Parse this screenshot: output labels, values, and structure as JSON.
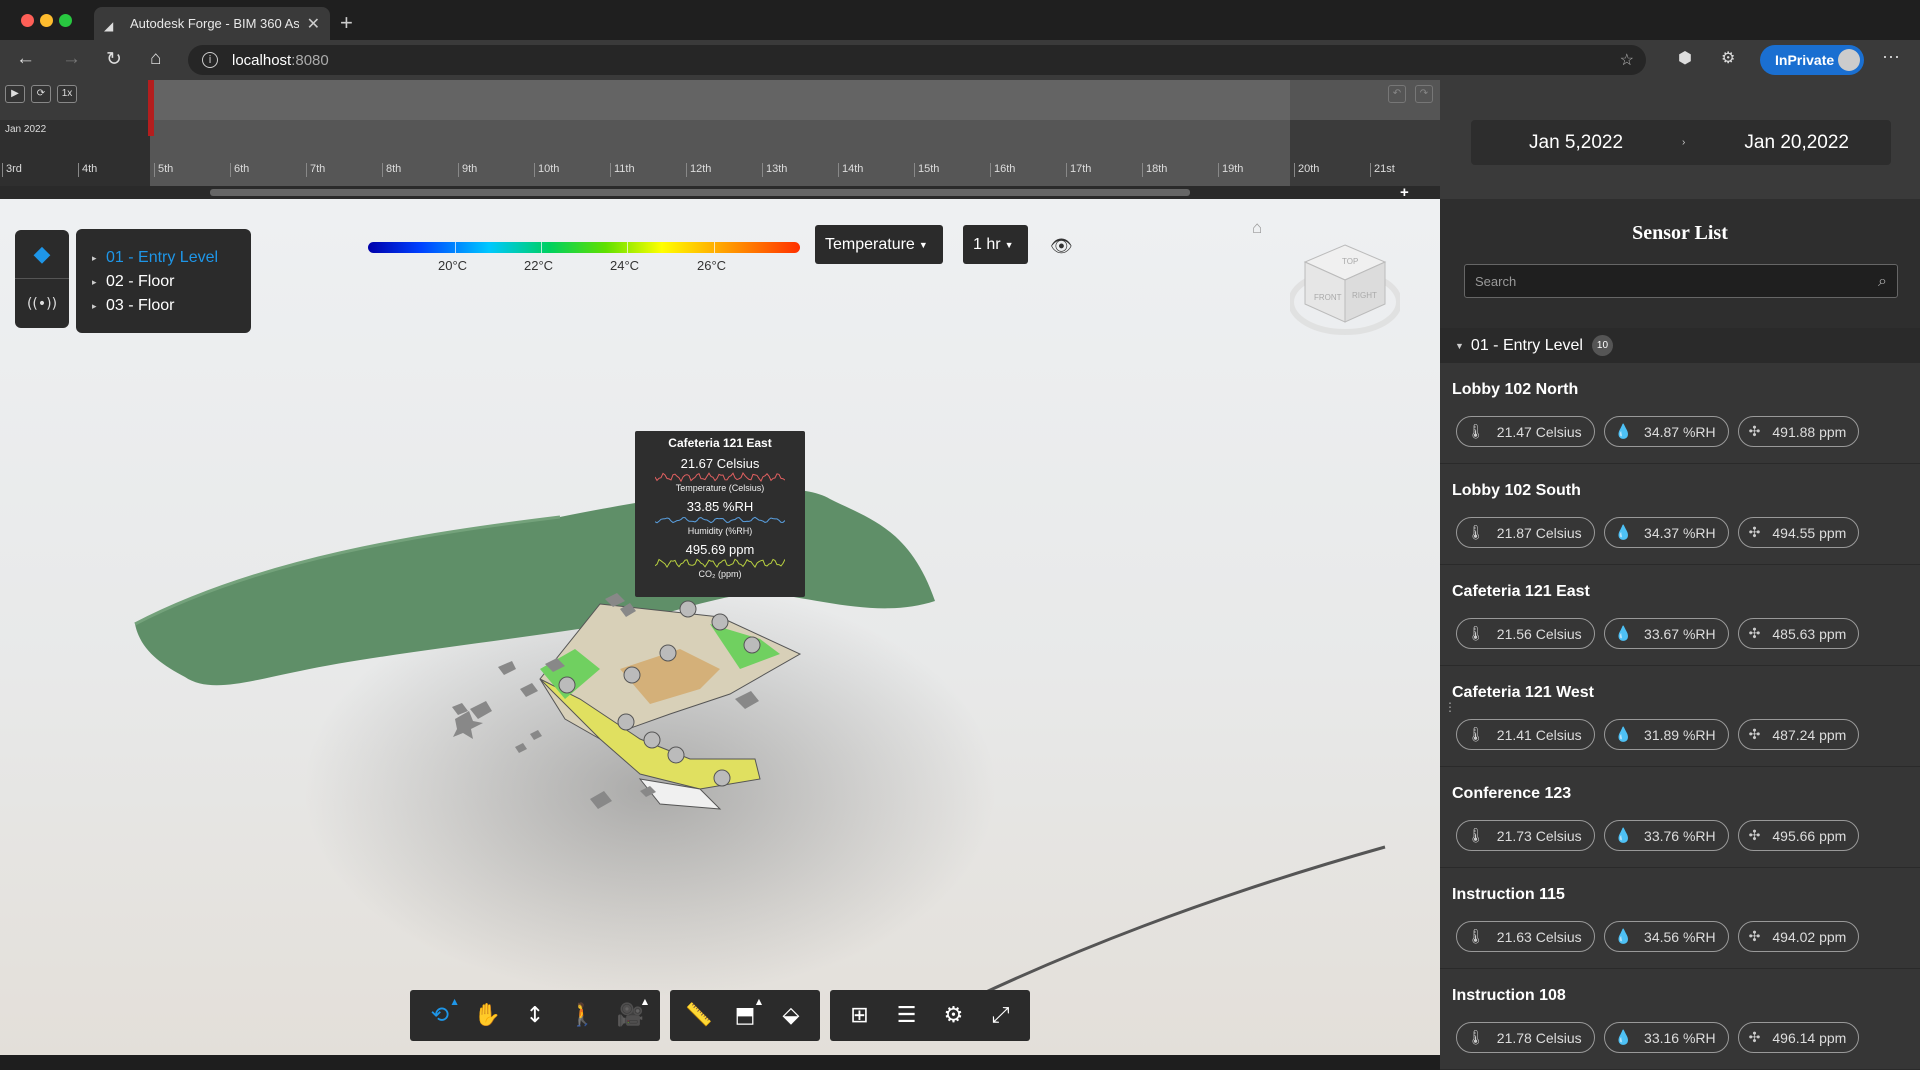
{
  "browser": {
    "tab_title": "Autodesk Forge - BIM 360 Ass",
    "url_host": "localhost",
    "url_port": ":8080",
    "inprivate_label": "InPrivate",
    "new_tab_glyph": "+",
    "close_glyph": "✕"
  },
  "timeline": {
    "month_label": "Jan 2022",
    "play_label": "▶",
    "speed_label": "1x",
    "ticks": [
      "3rd",
      "4th",
      "5th",
      "6th",
      "7th",
      "8th",
      "9th",
      "10th",
      "11th",
      "12th",
      "13th",
      "14th",
      "15th",
      "16th",
      "17th",
      "18th",
      "19th",
      "20th",
      "21st"
    ],
    "add_label": "+"
  },
  "date_range": {
    "start": "Jan 5,2022",
    "separator": "›",
    "end": "Jan 20,2022"
  },
  "levels": {
    "items": [
      {
        "label": "01 - Entry Level",
        "active": true
      },
      {
        "label": "02 - Floor",
        "active": false
      },
      {
        "label": "03 - Floor",
        "active": false
      }
    ]
  },
  "scale": {
    "labels": [
      "20°C",
      "22°C",
      "24°C",
      "26°C"
    ],
    "property_dropdown": "Temperature",
    "resolution_dropdown": "1 hr"
  },
  "navcube": {
    "top_label": "TOP",
    "front_label": "FRONT",
    "right_label": "RIGHT"
  },
  "tooltip": {
    "title": "Cafeteria 121 East",
    "temperature_value": "21.67 Celsius",
    "temperature_caption": "Temperature (Celsius)",
    "humidity_value": "33.85 %RH",
    "humidity_caption": "Humidity (%RH)",
    "co2_value": "495.69 ppm",
    "co2_caption": "CO₂ (ppm)",
    "colors": {
      "temperature": "#e06060",
      "humidity": "#5aa0e0",
      "co2": "#b8d040"
    }
  },
  "toolbar": {
    "icons": [
      "orbit-icon",
      "pan-icon",
      "zoom-icon",
      "first-person-icon",
      "camera-icon",
      "measure-icon",
      "section-icon",
      "explode-icon",
      "model-browser-icon",
      "properties-icon",
      "settings-icon",
      "fullscreen-icon"
    ]
  },
  "sensor_panel": {
    "title": "Sensor List",
    "search_placeholder": "Search",
    "group_label": "01 - Entry Level",
    "group_count": "10",
    "sensors": [
      {
        "name": "Lobby 102 North",
        "temperature": "21.47 Celsius",
        "humidity": "34.87 %RH",
        "co2": "491.88 ppm"
      },
      {
        "name": "Lobby 102 South",
        "temperature": "21.87 Celsius",
        "humidity": "34.37 %RH",
        "co2": "494.55 ppm"
      },
      {
        "name": "Cafeteria 121 East",
        "temperature": "21.56 Celsius",
        "humidity": "33.67 %RH",
        "co2": "485.63 ppm"
      },
      {
        "name": "Cafeteria 121 West",
        "temperature": "21.41 Celsius",
        "humidity": "31.89 %RH",
        "co2": "487.24 ppm"
      },
      {
        "name": "Conference 123",
        "temperature": "21.73 Celsius",
        "humidity": "33.76 %RH",
        "co2": "495.66 ppm"
      },
      {
        "name": "Instruction 115",
        "temperature": "21.63 Celsius",
        "humidity": "34.56 %RH",
        "co2": "494.02 ppm"
      },
      {
        "name": "Instruction 108",
        "temperature": "21.78 Celsius",
        "humidity": "33.16 %RH",
        "co2": "496.14 ppm"
      }
    ]
  },
  "colors": {
    "accent": "#1e96e8",
    "panel": "#2e2e2e",
    "inprivate": "#1a6fd1",
    "timeline_marker": "#b41e1e"
  }
}
